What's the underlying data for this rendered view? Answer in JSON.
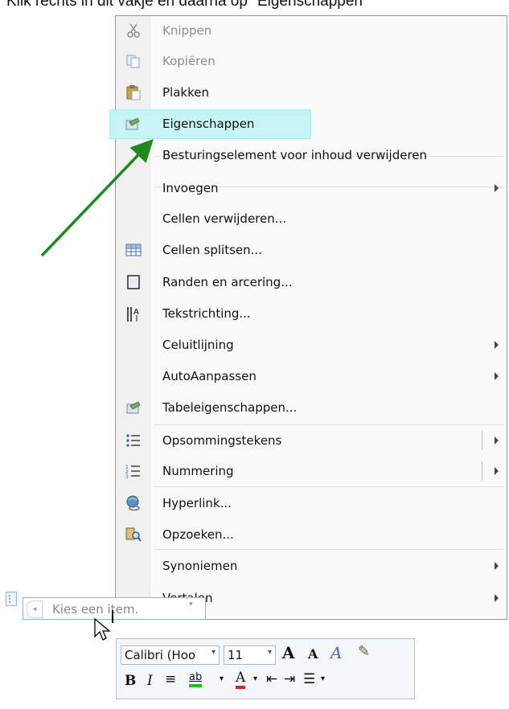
{
  "instruction": "Klik rechts in dit vakje en daarna op \"Eigenschappen\"",
  "menu": {
    "items": [
      {
        "label": "Knippen",
        "icon": "scissors-icon",
        "disabled": true,
        "submenu": false
      },
      {
        "label": "Kopiëren",
        "icon": "copy-icon",
        "disabled": true,
        "submenu": false
      },
      {
        "label": "Plakken",
        "icon": "paste-icon",
        "disabled": false,
        "submenu": false
      },
      {
        "label": "Eigenschappen",
        "icon": "properties-icon",
        "disabled": false,
        "submenu": false,
        "highlighted": true
      },
      {
        "label": "Besturingselement voor inhoud verwijderen",
        "icon": "",
        "disabled": false,
        "submenu": false
      },
      {
        "label": "Invoegen",
        "icon": "",
        "disabled": false,
        "submenu": true
      },
      {
        "label": "Cellen verwijderen...",
        "icon": "",
        "disabled": false,
        "submenu": false
      },
      {
        "label": "Cellen splitsen...",
        "icon": "split-cells-icon",
        "disabled": false,
        "submenu": false
      },
      {
        "label": "Randen en arcering...",
        "icon": "borders-icon",
        "disabled": false,
        "submenu": false
      },
      {
        "label": "Tekstrichting...",
        "icon": "text-direction-icon",
        "disabled": false,
        "submenu": false
      },
      {
        "label": "Celuitlijning",
        "icon": "",
        "disabled": false,
        "submenu": true
      },
      {
        "label": "AutoAanpassen",
        "icon": "",
        "disabled": false,
        "submenu": true
      },
      {
        "label": "Tabeleigenschappen...",
        "icon": "table-properties-icon",
        "disabled": false,
        "submenu": false
      },
      {
        "label": "Opsommingstekens",
        "icon": "bullets-icon",
        "disabled": false,
        "submenu": true,
        "split": true
      },
      {
        "label": "Nummering",
        "icon": "numbering-icon",
        "disabled": false,
        "submenu": true,
        "split": true
      },
      {
        "label": "Hyperlink...",
        "icon": "hyperlink-icon",
        "disabled": false,
        "submenu": false
      },
      {
        "label": "Opzoeken...",
        "icon": "research-icon",
        "disabled": false,
        "submenu": false
      },
      {
        "label": "Synoniemen",
        "icon": "",
        "disabled": false,
        "submenu": true
      },
      {
        "label": "Vertalen",
        "icon": "",
        "disabled": false,
        "submenu": true
      }
    ]
  },
  "content_control": {
    "placeholder": "Kies een item."
  },
  "mini_toolbar": {
    "font": "Calibri (Hoo",
    "size": "11",
    "bold": "B",
    "italic": "I",
    "grow_font": "A",
    "shrink_font": "A",
    "font_color": "A",
    "highlight": "ab"
  },
  "colors": {
    "highlight_bg": "#c7f4f4",
    "arrow": "#1e8a1e",
    "content_control_border": "#8fb2d8"
  }
}
